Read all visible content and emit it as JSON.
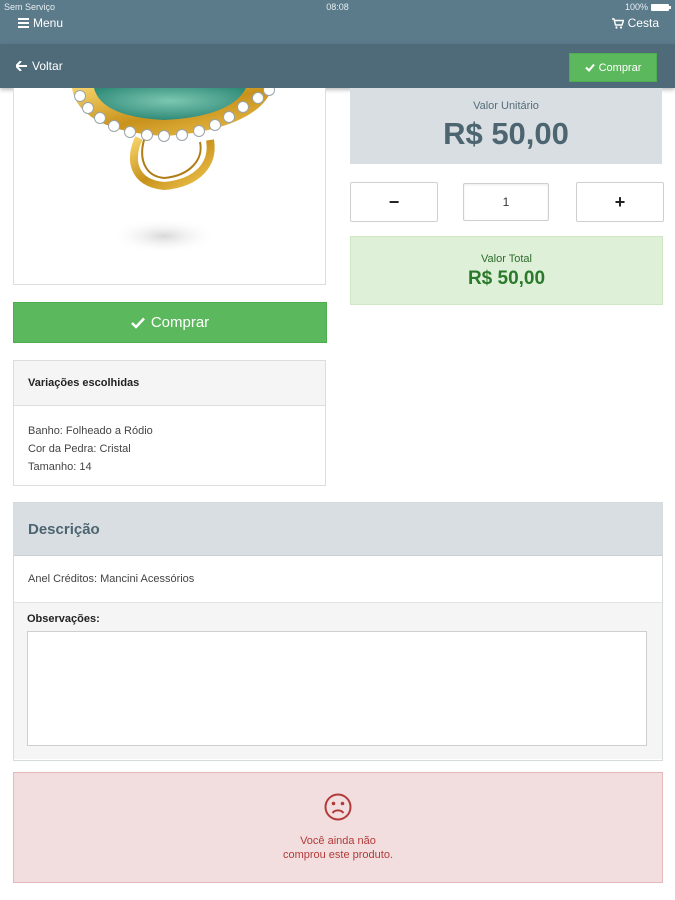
{
  "status": {
    "carrier": "Sem Serviço",
    "time": "08:08",
    "battery": "100%"
  },
  "header": {
    "menu_label": "Menu",
    "cart_label": "Cesta"
  },
  "navbar": {
    "back_label": "Voltar",
    "buy_label": "Comprar"
  },
  "product": {
    "unit_price_label": "Valor Unitário",
    "unit_price": "R$ 50,00",
    "quantity": "1",
    "minus_label": "−",
    "plus_label": "+",
    "total_label": "Valor Total",
    "total_price": "R$ 50,00",
    "buy_label": "Comprar"
  },
  "variations": {
    "title": "Variações escolhidas",
    "items": [
      "Banho: Folheado a Ródio",
      "Cor da Pedra: Cristal",
      "Tamanho: 14"
    ]
  },
  "description": {
    "title": "Descrição",
    "text": "Anel Créditos: Mancini Acessórios",
    "observations_label": "Observações:",
    "observations_value": ""
  },
  "alert": {
    "line1": "Você ainda não",
    "line2": "comprou este produto."
  },
  "colors": {
    "header": "#5b7a8a",
    "navbar": "#4f6b79",
    "success": "#5cb85c",
    "price_box": "#d9dee2",
    "total_box": "#dff0d8",
    "alert_bg": "#f2dede",
    "alert_text": "#b23a3a"
  }
}
